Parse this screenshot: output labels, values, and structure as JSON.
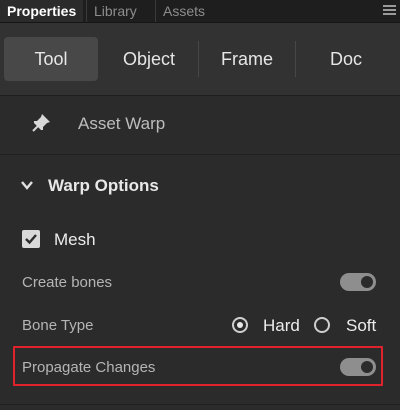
{
  "panel_tabs": [
    {
      "label": "Properties",
      "active": true
    },
    {
      "label": "Library",
      "active": false
    },
    {
      "label": "Assets",
      "active": false
    }
  ],
  "mode_tabs": [
    {
      "label": "Tool",
      "selected": true
    },
    {
      "label": "Object",
      "selected": false
    },
    {
      "label": "Frame",
      "selected": false
    },
    {
      "label": "Doc",
      "selected": false
    }
  ],
  "tool": {
    "name": "Asset Warp",
    "icon": "pin-icon"
  },
  "section": {
    "title": "Warp Options",
    "expanded": true
  },
  "mesh": {
    "label": "Mesh",
    "checked": true
  },
  "create_bones": {
    "label": "Create bones",
    "on": true
  },
  "bone_type": {
    "label": "Bone Type",
    "options": [
      {
        "label": "Hard",
        "selected": true
      },
      {
        "label": "Soft",
        "selected": false
      }
    ]
  },
  "propagate_changes": {
    "label": "Propagate Changes",
    "on": true
  },
  "colors": {
    "highlight": "#e0222d",
    "background": "#2b2b2b"
  }
}
